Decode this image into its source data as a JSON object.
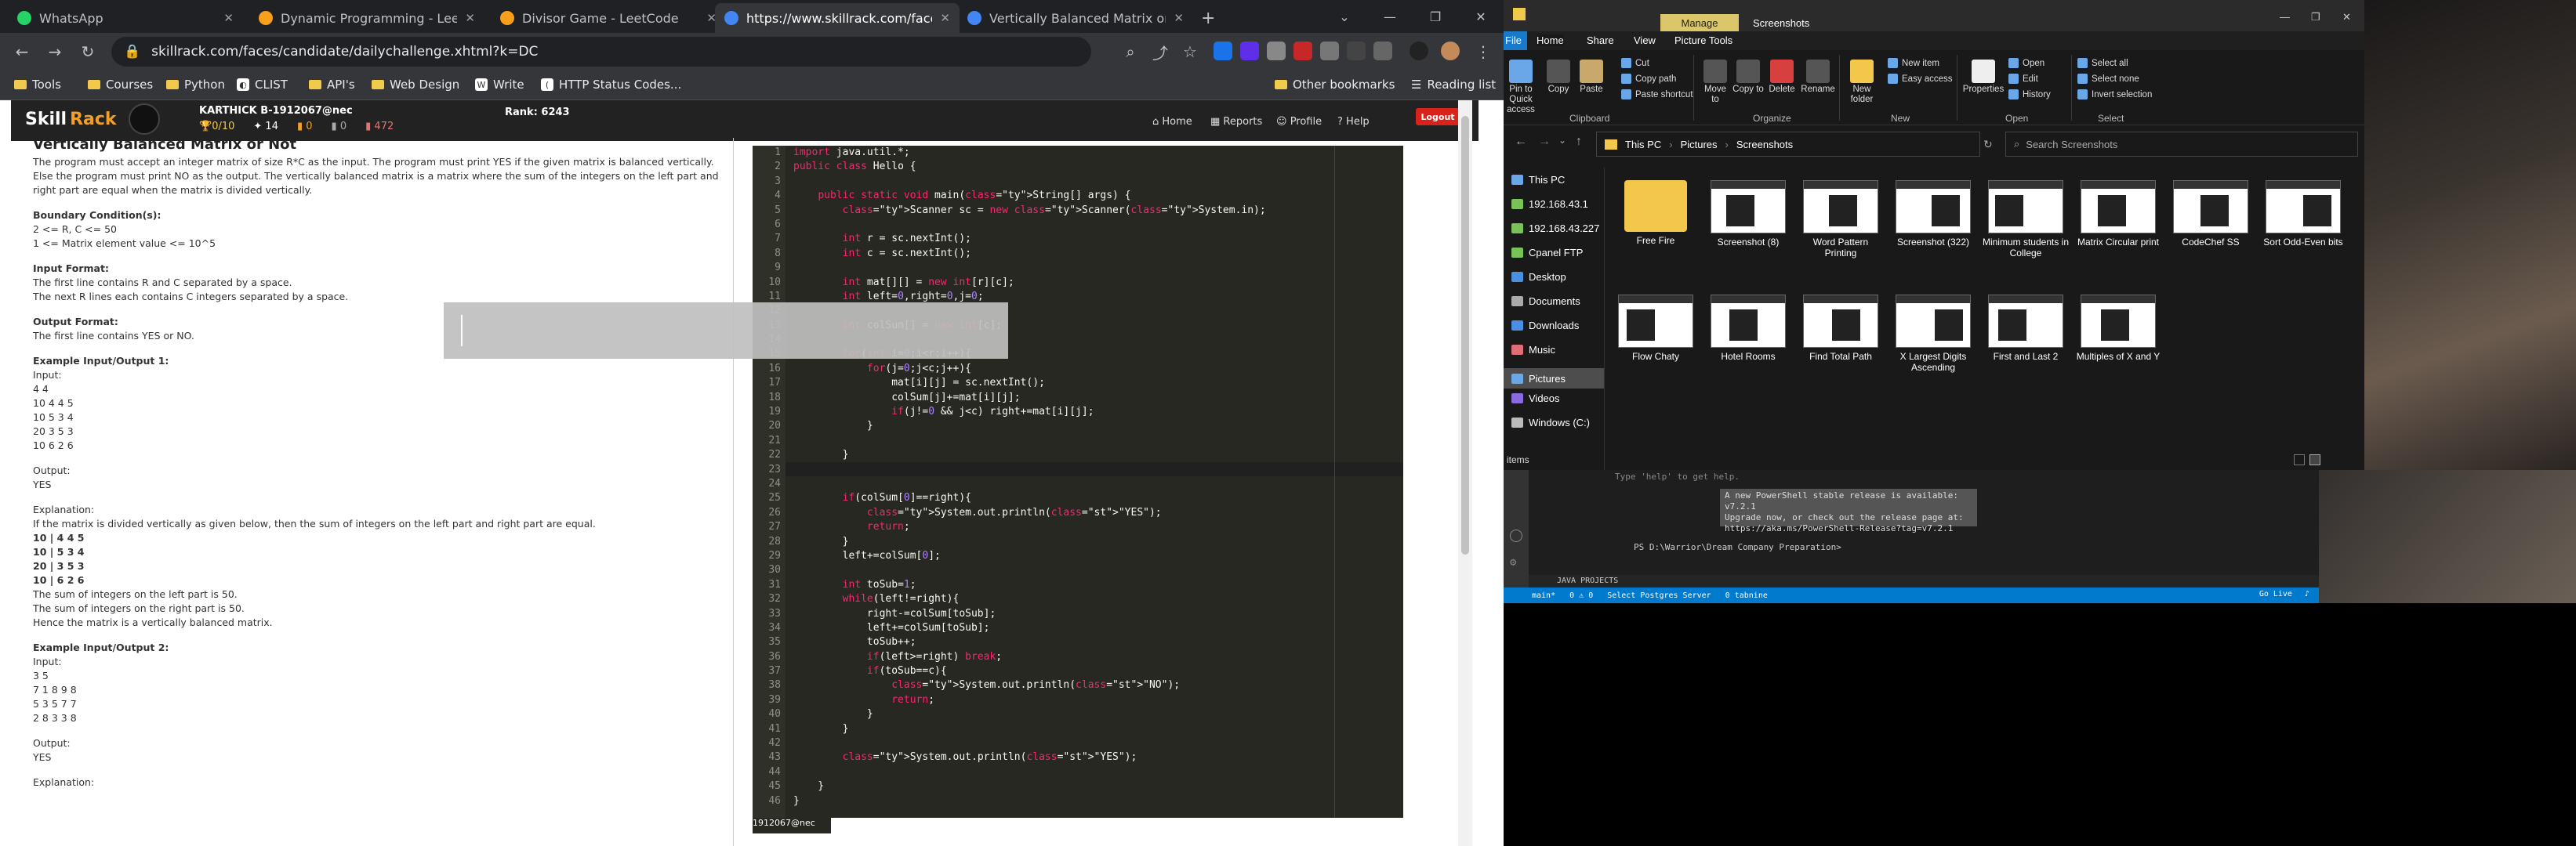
{
  "browser": {
    "tabs": [
      {
        "label": "WhatsApp",
        "color": "#25d366",
        "active": false
      },
      {
        "label": "Dynamic Programming - LeetCo",
        "color": "#f89f1b",
        "active": false
      },
      {
        "label": "Divisor Game - LeetCode",
        "color": "#f89f1b",
        "active": false
      },
      {
        "label": "https://www.skillrack.com/faces/c",
        "color": "#4285f4",
        "active": true
      },
      {
        "label": "Vertically Balanced Matrix or No",
        "color": "#4285f4",
        "active": false
      }
    ],
    "new_tab_label": "+",
    "url": "skillrack.com/faces/candidate/dailychallenge.xhtml?k=DC",
    "bookmarks": [
      "Tools",
      "Courses",
      "Python",
      "CLIST",
      "API's",
      "Web Design",
      "Write",
      "HTTP Status Codes...",
      "Other bookmarks",
      "Reading list"
    ]
  },
  "skillrack": {
    "logo_skill": "Skill",
    "logo_rack": "Rack",
    "user": "KARTHICK B-1912067@nec",
    "stats": [
      "0/10",
      "14",
      "0",
      "0",
      "472"
    ],
    "rank": "Rank: 6243",
    "nav": [
      "Home",
      "Reports",
      "Profile",
      "Help"
    ],
    "logout": "Logout",
    "problem_title": "Vertically Balanced Matrix or Not",
    "description_1": "The program must accept an integer matrix of size R*C as the input. The program must print YES if the given matrix is balanced vertically. Else the program must print NO as the output. The vertically balanced matrix is a matrix where the sum of the integers on the left part and right part are equal when the matrix is divided vertically.",
    "boundary_title": "Boundary Condition(s):",
    "boundary_1": "2 <= R, C <= 50",
    "boundary_2": "1 <= Matrix element value <= 10^5",
    "input_title": "Input Format:",
    "input_1": "The first line contains R and C separated by a space.",
    "input_2": "The next R lines each contains C integers separated by a space.",
    "output_title": "Output Format:",
    "output_1": "The first line contains YES or NO.",
    "ex1_title": "Example Input/Output 1:",
    "input_label": "Input:",
    "ex1_input": [
      "4 4",
      "10 4 4 5",
      "10 5 3 4",
      "20 3 5 3",
      "10 6 2 6"
    ],
    "output_label": "Output:",
    "ex1_output": "YES",
    "explanation_label": "Explanation:",
    "ex1_expl_1": "If the matrix is divided vertically as given below, then the sum of integers on the left part and right part are equal.",
    "ex1_split": [
      "10 | 4 4 5",
      "10 | 5 3 4",
      "20 | 3 5 3",
      "10 | 6 2 6"
    ],
    "ex1_expl_2": "The sum of integers on the left part is 50.",
    "ex1_expl_3": "The sum of integers on the right part is 50.",
    "ex1_expl_4": "Hence the matrix is a vertically balanced matrix.",
    "ex2_title": "Example Input/Output 2:",
    "ex2_input": [
      "3 5",
      "7 1 8 9 8",
      "5 3 5 7 7",
      "2 8 3 3 8"
    ],
    "ex2_output": "YES",
    "editor_footer": "1912067@nec"
  },
  "code_lines": [
    "import java.util.*;",
    "public class Hello {",
    "",
    "    public static void main(String[] args) {",
    "        Scanner sc = new Scanner(System.in);",
    "",
    "        int r = sc.nextInt();",
    "        int c = sc.nextInt();",
    "",
    "        int mat[][] = new int[r][c];",
    "        int left=0,right=0,j=0;",
    "",
    "        int colSum[] = new int[c];",
    "",
    "        for(int i=0;i<r;i++){",
    "            for(j=0;j<c;j++){",
    "                mat[i][j] = sc.nextInt();",
    "                colSum[j]+=mat[i][j];",
    "                if(j!=0 && j<c) right+=mat[i][j];",
    "            }",
    "",
    "        }",
    "",
    "",
    "        if(colSum[0]==right){",
    "            System.out.println(\"YES\");",
    "            return;",
    "        }",
    "        left+=colSum[0];",
    "",
    "        int toSub=1;",
    "        while(left!=right){",
    "            right-=colSum[toSub];",
    "            left+=colSum[toSub];",
    "            toSub++;",
    "            if(left>=right) break;",
    "            if(toSub==c){",
    "                System.out.println(\"NO\");",
    "                return;",
    "            }",
    "        }",
    "",
    "        System.out.println(\"YES\");",
    "",
    "    }",
    "}"
  ],
  "explorer": {
    "manage": "Manage",
    "title": "Screenshots",
    "ribbon_tabs": [
      "File",
      "Home",
      "Share",
      "View",
      "Picture Tools"
    ],
    "ribbon_groups": [
      "Clipboard",
      "Organize",
      "New",
      "Open",
      "Select"
    ],
    "ribbon_buttons": [
      "Pin to Quick access",
      "Copy",
      "Paste",
      "Move to",
      "Copy to",
      "Delete",
      "Rename",
      "New folder",
      "Properties"
    ],
    "ribbon_small": [
      "Cut",
      "Copy path",
      "Paste shortcut",
      "New item",
      "Easy access",
      "Open",
      "Edit",
      "History",
      "Select all",
      "Select none",
      "Invert selection"
    ],
    "path": [
      "This PC",
      "Pictures",
      "Screenshots"
    ],
    "search_placeholder": "Search Screenshots",
    "sidebar": [
      "This PC",
      "192.168.43.1",
      "192.168.43.227",
      "Cpanel FTP",
      "Desktop",
      "Documents",
      "Downloads",
      "Music",
      "Pictures",
      "Videos",
      "Windows (C:)"
    ],
    "files": [
      "Free Fire",
      "Screenshot (8)",
      "Word Pattern Printing",
      "Screenshot (322)",
      "Minimum students in College",
      "Matrix Circular print",
      "CodeChef SS",
      "Sort Odd-Even bits",
      "Flow Chaty",
      "Hotel Rooms",
      "Find Total Path",
      "X Largest Digits Ascending",
      "First and Last 2",
      "Multiples of X and Y"
    ],
    "status": "items"
  },
  "vscode": {
    "term_line_1": "Type 'help' to get help.",
    "warn_1": "A new PowerShell stable release is available: v7.2.1",
    "warn_2": "Upgrade now, or check out the release page at:",
    "warn_3": "  https://aka.ms/PowerShell-Release?tag=v7.2.1",
    "prompt": "PS D:\\Warrior\\Dream Company Preparation>",
    "java_projects": "JAVA PROJECTS",
    "status_left": [
      "main*",
      "0 ⚠ 0",
      "Select Postgres Server",
      "0 tabnine"
    ],
    "status_right": [
      "Go Live"
    ]
  }
}
